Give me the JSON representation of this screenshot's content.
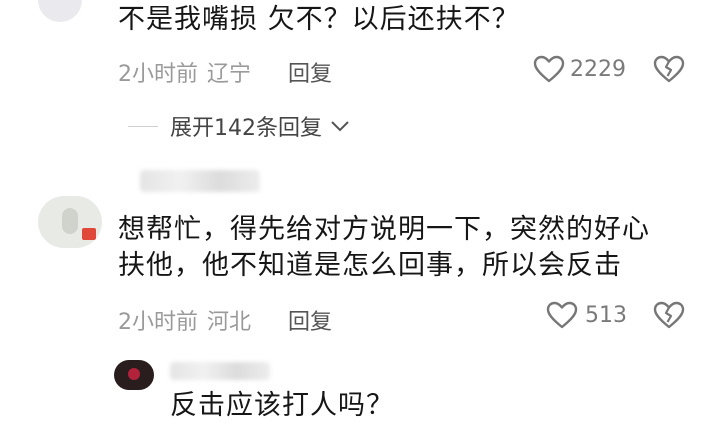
{
  "comment1": {
    "text": "不是我嘴损 欠不？以后还扶不？",
    "time": "2小时前",
    "location": "辽宁",
    "reply_label": "回复",
    "like_count": "2229"
  },
  "expand_replies": {
    "label": "展开142条回复"
  },
  "comment2": {
    "line1": "想帮忙，得先给对方说明一下，突然的好心",
    "line2": "扶他，他不知道是怎么回事，所以会反击",
    "time": "2小时前",
    "location": "河北",
    "reply_label": "回复",
    "like_count": "513"
  },
  "reply1": {
    "text": "反击应该打人吗？"
  },
  "icons": {
    "like": "heart-outline-icon",
    "dislike": "broken-heart-icon",
    "expand": "chevron-down-icon"
  },
  "colors": {
    "text": "#161616",
    "meta": "#9a9a9a",
    "icon": "#777777"
  }
}
